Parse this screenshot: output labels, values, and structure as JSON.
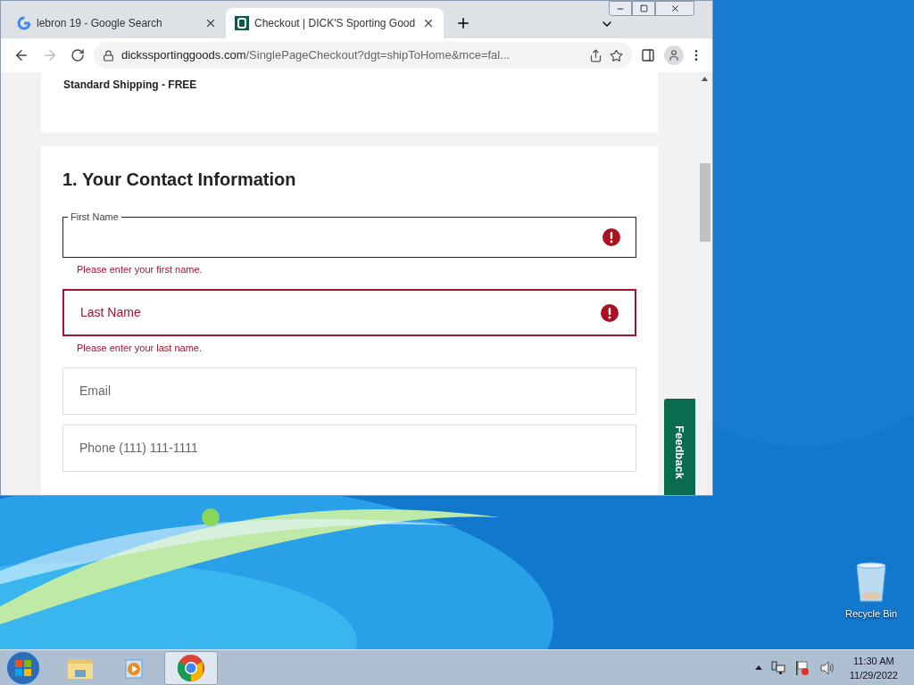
{
  "browser": {
    "tabs": [
      {
        "title": "lebron 19 - Google Search",
        "kind": "google",
        "selected": false
      },
      {
        "title": "Checkout | DICK'S Sporting Good",
        "kind": "dicks",
        "selected": true
      }
    ],
    "url": {
      "domain": "dickssportinggoods.com",
      "path": "/SinglePageCheckout?dgt=shipToHome&mce=fal..."
    }
  },
  "page": {
    "shipping_summary": "Standard Shipping - FREE",
    "section_title": "1. Your Contact Information",
    "fields": [
      {
        "label": "First Name",
        "focused": true,
        "error": true,
        "error_message": "Please enter your first name."
      },
      {
        "label": "Last Name",
        "focused": false,
        "error": true,
        "error_message": "Please enter your last name."
      },
      {
        "label": "Email",
        "focused": false,
        "error": false
      },
      {
        "label": "Phone (111) 111-1111",
        "focused": false,
        "error": false
      }
    ],
    "feedback_button": "Feedback"
  },
  "desktop_icons": [
    {
      "label": "Recycle Bin"
    }
  ],
  "taskbar": {
    "apps": [
      {
        "kind": "explorer",
        "selected": false
      },
      {
        "kind": "media",
        "selected": false
      },
      {
        "kind": "chrome",
        "selected": true
      }
    ],
    "time": "11:30 AM",
    "date": "11/29/2022"
  }
}
